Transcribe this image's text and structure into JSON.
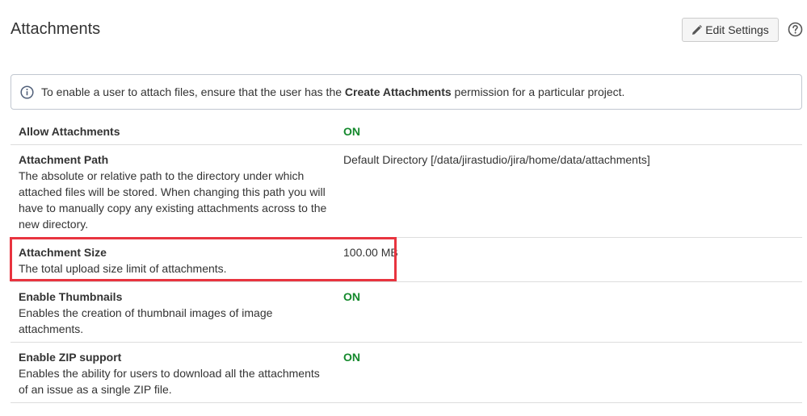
{
  "header": {
    "title": "Attachments",
    "edit_settings_label": "Edit Settings",
    "edit_icon": "pencil-icon",
    "help_icon": "help-icon"
  },
  "info_message": {
    "icon": "info-icon",
    "text_before": "To enable a user to attach files, ensure that the user has the ",
    "text_bold": "Create Attachments",
    "text_after": " permission for a particular project."
  },
  "settings": [
    {
      "name": "Allow Attachments",
      "description": "",
      "value": "ON"
    },
    {
      "name": "Attachment Path",
      "description": "The absolute or relative path to the directory under which attached files will be stored. When changing this path you will have to manually copy any existing attachments across to the new directory.",
      "value": "Default Directory [/data/jirastudio/jira/home/data/attachments]"
    },
    {
      "name": "Attachment Size",
      "description": "The total upload size limit of attachments.",
      "value": "100.00 MB"
    },
    {
      "name": "Enable Thumbnails",
      "description": "Enables the creation of thumbnail images of image attachments.",
      "value": "ON"
    },
    {
      "name": "Enable ZIP support",
      "description": "Enables the ability for users to download all the attachments of an issue as a single ZIP file.",
      "value": "ON"
    }
  ],
  "colors": {
    "on_status": "#14892c",
    "highlight_border": "#e8343f"
  }
}
